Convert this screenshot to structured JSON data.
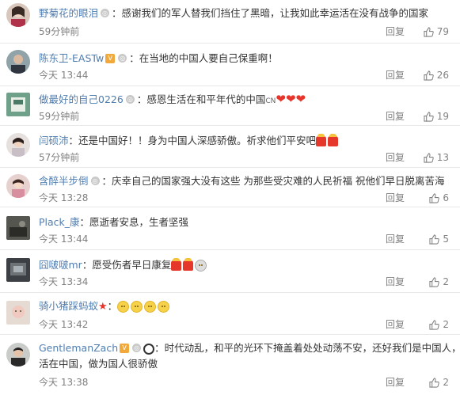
{
  "comments": [
    {
      "name": "野菊花的眼泪",
      "text": "：感谢我们的军人替我们挡住了黑暗，让我如此幸运活在没有战争的国家",
      "time": "59分钟前",
      "reply": "回复",
      "likes": "79"
    },
    {
      "name": "陈东卫-EASTw",
      "text": "：在当地的中国人要自己保重啊！",
      "time": "今天 13:44",
      "reply": "回复",
      "likes": "26"
    },
    {
      "name": "做最好的自己0226",
      "text": "：感恩生活在和平年代的中国",
      "flag": "CN",
      "time": "59分钟前",
      "reply": "回复",
      "likes": "19"
    },
    {
      "name": "闫硕沛",
      "text": "：还是中国好！！身为中国人深感骄傲。祈求他们平安吧",
      "time": "57分钟前",
      "reply": "回复",
      "likes": "13"
    },
    {
      "name": "含醉半步倒",
      "text": "：庆幸自己的国家强大没有这些  为那些受灾难的人民祈福  祝他们早日脱离苦海",
      "time": "今天 13:28",
      "reply": "回复",
      "likes": "6"
    },
    {
      "name": "Plack_康",
      "text": "：愿逝者安息，生者坚强",
      "time": "今天 13:44",
      "reply": "回复",
      "likes": "5"
    },
    {
      "name": "囧啵啵mr",
      "text": "：愿受伤者早日康复",
      "time": "今天 13:34",
      "reply": "回复",
      "likes": "2"
    },
    {
      "name": "骑小猪踩蚂蚁",
      "text": "：",
      "time": "今天 13:42",
      "reply": "回复",
      "likes": "2"
    },
    {
      "name": "GentlemanZach",
      "text": "：时代动乱，和平的光环下掩盖着处处动荡不安，还好我们是中国人，生",
      "text2": "活在中国，做为国人很骄傲",
      "time": "今天 13:38",
      "reply": "回复",
      "likes": "2"
    }
  ],
  "colors": {
    "name_orange": "#eb7350",
    "name_blue": "#507daf",
    "meta_gray": "#808080",
    "text": "#333333",
    "divider": "#e8e8e8"
  },
  "icons": {
    "verified_badge": "user-level-badge",
    "like": "thumbs-up-icon"
  }
}
